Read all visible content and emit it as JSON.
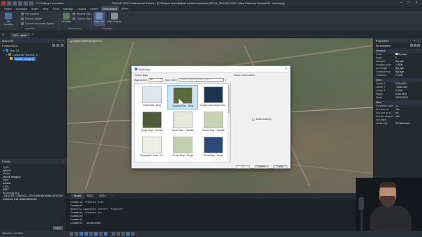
{
  "title_bar": {
    "title": "ZWCAD 2025 Professional Edition - [D:\\Shared drive\\Balban Architect\\youtube\\25Y24_ZWCAD 2025 - New Features Review\\06 - start.dwg]",
    "quick_access_label": "2D Drafting & Annotation"
  },
  "menu": [
    "Home",
    "Annotate",
    "Insert",
    "View",
    "Tools",
    "Manage",
    "Output",
    "Online",
    "Geolocation",
    "APPs"
  ],
  "ribbon": {
    "big_buttons": [
      {
        "label": "Set Location"
      },
      {
        "label": "Coordinate System"
      },
      {
        "label": "Add Data"
      },
      {
        "label": "Map Unit"
      },
      {
        "label": "Map Controls"
      }
    ],
    "small_buttons": [
      "Edit Location",
      "Reorient Marker",
      "Convert Coordinate System",
      "Remove Map",
      "Capture Map"
    ],
    "groups": [
      "Location",
      "Map Service",
      "Manager"
    ]
  },
  "file_tabs": [
    "GIS - start*"
  ],
  "map_unit_panel": {
    "title": "Map Unit",
    "toolbar_label": "Features(Or)",
    "tree": [
      {
        "label": "Map 01",
        "level": 0
      },
      {
        "label": "Customer Service_D",
        "level": 1
      },
      {
        "label": "World_Imagery",
        "level": 2,
        "selected": true
      }
    ]
  },
  "details_panel": {
    "title": "Details",
    "fields": [
      {
        "key": "Type:",
        "value": "WMTS"
      },
      {
        "key": "Name:",
        "value": "World_Imagery"
      },
      {
        "key": "style:",
        "value": "default"
      },
      {
        "key": "CRS:",
        "value": "3857"
      },
      {
        "key": "Bounding box:",
        "value": "-20037507.2280042,-19971868.8804086,20037507.2280042,19971868.8804086"
      }
    ],
    "import_label": "Import"
  },
  "viewport": {
    "label": "[-][Top][2D Wireframe][WCS]"
  },
  "layout_tabs": [
    "Model",
    "布局1",
    "布局2"
  ],
  "command_lines": [
    "Command: <Coords off>",
    "Command:",
    "Specify opposite corner: *Cancel*",
    "Command: <Coords on>",
    "Command:",
    "Command:",
    "Command: _addgeomap"
  ],
  "status_bar": {
    "coordinates": "985.6097, 96.7602"
  },
  "properties_panel": {
    "title": "Properties",
    "selection": "No selection",
    "sections": [
      {
        "name": "General",
        "rows": [
          {
            "key": "Color",
            "value": "ByLayer"
          },
          {
            "key": "Layer",
            "value": "0"
          },
          {
            "key": "Linetype",
            "value": "ByLayer"
          },
          {
            "key": "Linetype scale",
            "value": "1.0000"
          },
          {
            "key": "Lineweight",
            "value": "ByLayer"
          },
          {
            "key": "Transparency",
            "value": "ByLayer"
          },
          {
            "key": "Thickness",
            "value": "0.0000"
          }
        ]
      },
      {
        "name": "View",
        "rows": [
          {
            "key": "Center X",
            "value": "5139.0281"
          },
          {
            "key": "Center Y",
            "value": "-1096.1994"
          },
          {
            "key": "Center Z",
            "value": "0.0000"
          },
          {
            "key": "Height",
            "value": "6739.4935"
          },
          {
            "key": "Width",
            "value": "11876.2978"
          }
        ]
      },
      {
        "name": "Misc",
        "rows": [
          {
            "key": "Annotation scale",
            "value": "1:1"
          },
          {
            "key": "Ucs icon on",
            "value": "Yes"
          },
          {
            "key": "Ucs icon at ori...",
            "value": "No"
          },
          {
            "key": "Ucs per viewport",
            "value": "Yes"
          },
          {
            "key": "Ucs name",
            "value": ""
          },
          {
            "key": "Visual style",
            "value": "2D Wireframe"
          }
        ]
      }
    ]
  },
  "add_map_dialog": {
    "title": "Add Map",
    "select_map_label": "Select Map",
    "map_source_label": "Map source",
    "map_source_value": "All",
    "map_name_label": "Map name",
    "search_placeholder": "Please input the content to be s",
    "basic_info_label": "Basic Information",
    "loading_text": "Data loading...",
    "maps": [
      {
        "name": "Road Map - Bing",
        "color": "#dde6ef"
      },
      {
        "name": "Imagery Map - Bing",
        "color": "#5b6a3c"
      },
      {
        "name": "Imagery Annotation Ma...",
        "color": "#1e3350"
      },
      {
        "name": "Image Map - Tianditu",
        "color": "#4f5a3a"
      },
      {
        "name": "Vector Map - Tianditu",
        "color": "#e4e8d8"
      },
      {
        "name": "Terrain Map - Tianditu",
        "color": "#c7d4b2"
      },
      {
        "name": "Topographic Note - Ar...",
        "color": "#eef0e8"
      },
      {
        "name": "Terrain Map - Arcgis",
        "color": "#c4cfb0"
      },
      {
        "name": "World Map - Arcgis",
        "color": "#2c4a78"
      }
    ],
    "ok_label": "OK",
    "cancel_label": "Cancel",
    "help_label": "Help"
  }
}
